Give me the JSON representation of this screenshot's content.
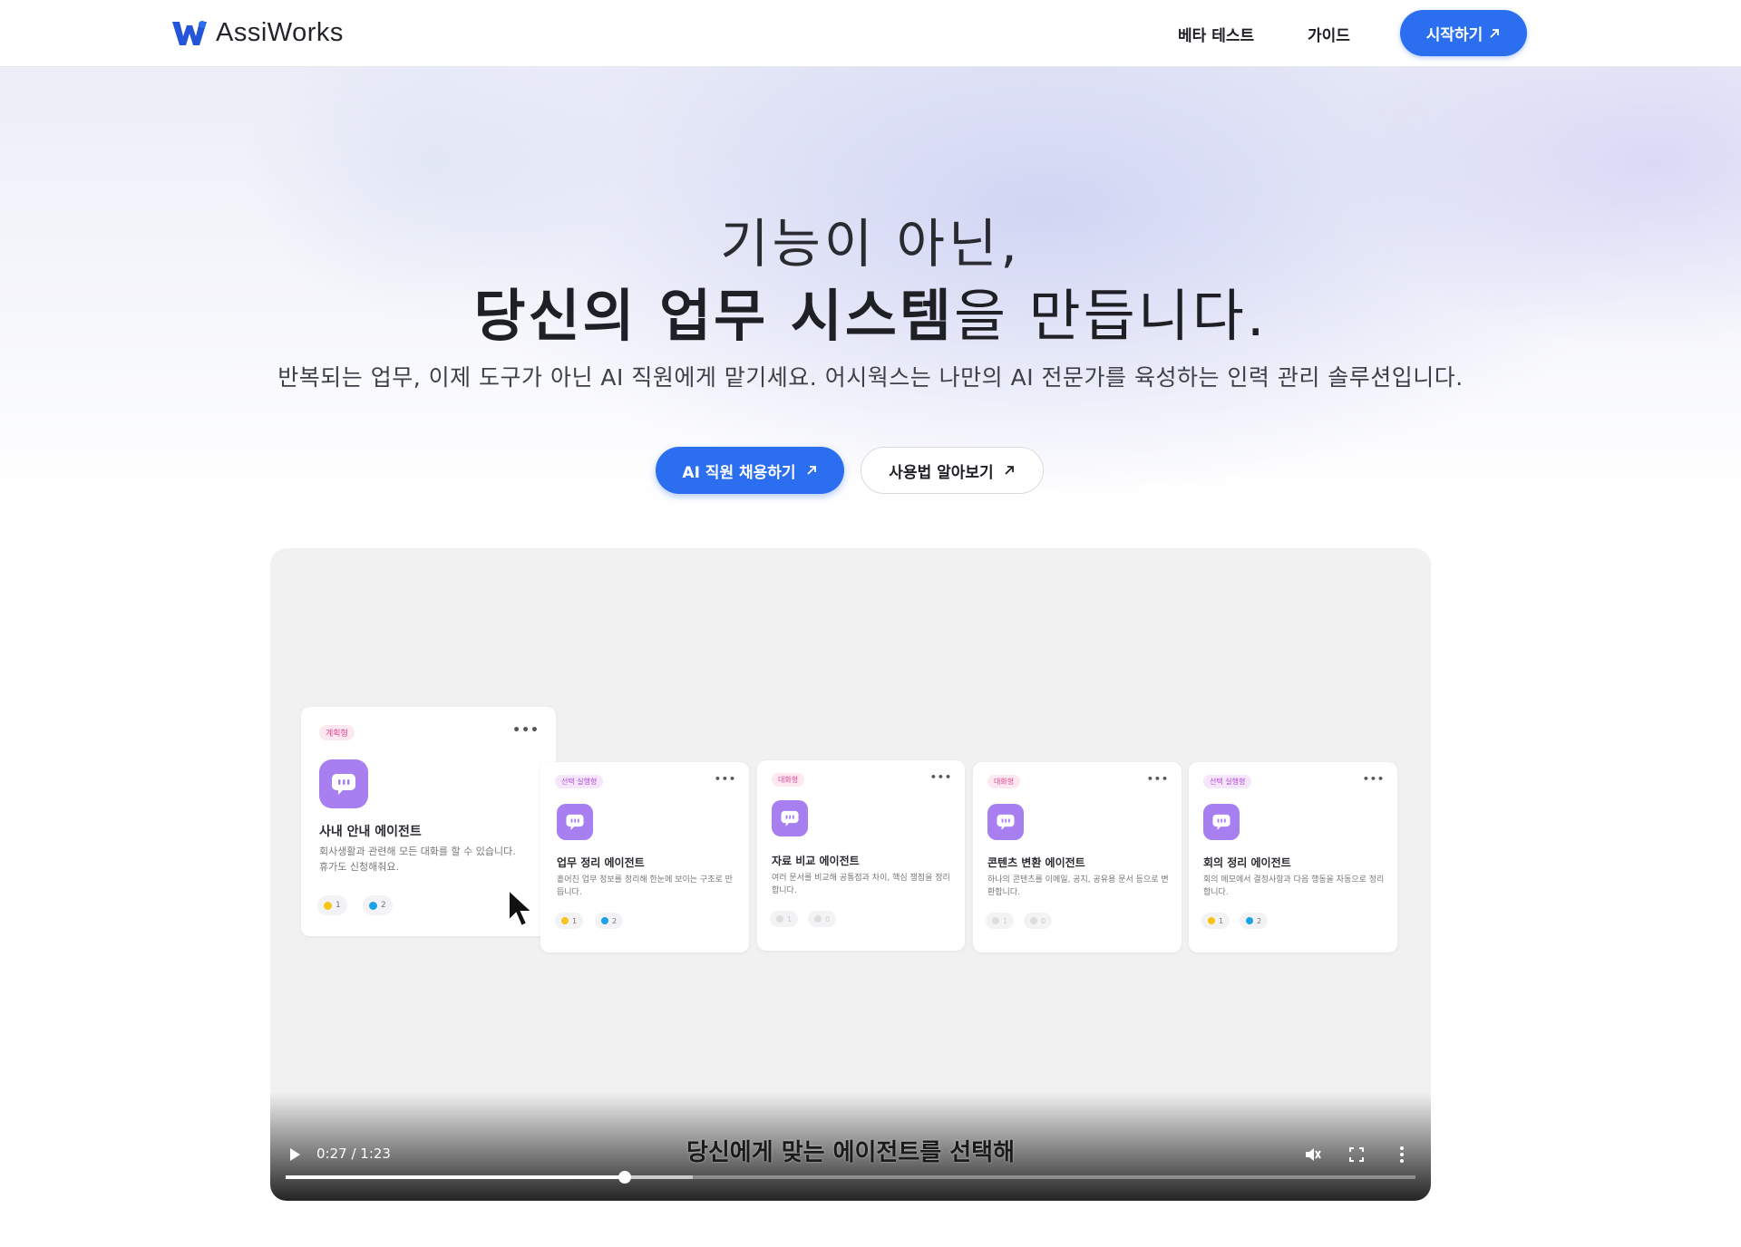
{
  "header": {
    "brand": "AssiWorks",
    "nav": {
      "beta_test": "베타 테스트",
      "guide": "가이드"
    },
    "start_button": "시작하기"
  },
  "hero": {
    "line1": "기능이 아닌,",
    "line2_bold": "당신의 업무 시스템",
    "line2_rest": "을 만듭니다.",
    "subtitle": "반복되는 업무, 이제 도구가 아닌 AI 직원에게 맡기세요. 어시웍스는 나만의 AI 전문가를 육성하는 인력 관리 솔루션입니다.",
    "cta_primary": "AI 직원 채용하기",
    "cta_secondary": "사용법 알아보기"
  },
  "colors": {
    "accent": "#2b6ef0",
    "agent_avatar": "#a77ff0"
  },
  "video": {
    "time": "0:27 / 1:23",
    "progress": 0.3,
    "buffered": 0.36,
    "caption": "당신에게 맞는 에이전트를 선택해",
    "icons": [
      "play-icon",
      "mute-icon",
      "fullscreen-icon",
      "more-vert-icon"
    ],
    "cards": [
      {
        "badge": "계획형",
        "title": "사내 안내 에이전트",
        "desc": "회사생활과 관련해 모든 대화를 할 수 있습니다. 휴가도 신청해줘요.",
        "chip1": "1",
        "chip2": "2"
      },
      {
        "badge": "선택 실행형",
        "title": "업무 정리 에이전트",
        "desc": "흩어진 업무 정보를 정리해 한눈에 보이는 구조로 만듭니다.",
        "chip1": "1",
        "chip2": "2"
      },
      {
        "badge": "대화형",
        "title": "자료 비교 에이전트",
        "desc": "여러 문서를 비교해 공통점과 차이, 핵심 쟁점을 정리합니다.",
        "chip1": "1",
        "chip2": "0"
      },
      {
        "badge": "대화형",
        "title": "콘텐츠 변환 에이전트",
        "desc": "하나의 콘텐츠를 이메일, 공지, 공유용 문서 등으로 변환합니다.",
        "chip1": "1",
        "chip2": "0"
      },
      {
        "badge": "선택 실행형",
        "title": "회의 정리 에이전트",
        "desc": "회의 메모에서 결정사항과 다음 행동을 자동으로 정리합니다.",
        "chip1": "1",
        "chip2": "2"
      }
    ]
  }
}
